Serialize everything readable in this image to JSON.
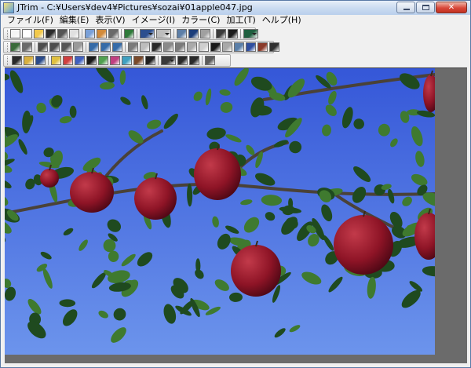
{
  "window": {
    "title": "JTrim - C:¥Users¥dev4¥Pictures¥sozai¥01apple047.jpg"
  },
  "menu": [
    {
      "label": "ファイル(F)"
    },
    {
      "label": "編集(E)"
    },
    {
      "label": "表示(V)"
    },
    {
      "label": "イメージ(I)"
    },
    {
      "label": "カラー(C)"
    },
    {
      "label": "加工(T)"
    },
    {
      "label": "ヘルプ(H)"
    }
  ],
  "toolbar_rows": [
    [
      {
        "name": "copy-window",
        "color": "#f5f5f5"
      },
      {
        "name": "new-file",
        "color": "#ffffff"
      },
      {
        "name": "open-folder",
        "color": "#f2c94c"
      },
      {
        "name": "save",
        "color": "#2b2b2b"
      },
      {
        "name": "print",
        "color": "#555555"
      },
      {
        "name": "print-preview",
        "color": "#e0e0e0"
      },
      "sep",
      {
        "name": "copy",
        "color": "#7aa0d8"
      },
      {
        "name": "paste",
        "color": "#d28b3b"
      },
      {
        "name": "paste-new",
        "color": "#6a6a6a"
      },
      "sep",
      {
        "name": "fill",
        "color": "#2f7a3a"
      },
      "sep",
      {
        "name": "undo",
        "color": "#2d4f8f",
        "dropdown": true
      },
      {
        "name": "redo",
        "color": "#bdbdbd",
        "dropdown": true
      },
      "sep",
      {
        "name": "zoom-fit",
        "color": "#5d7fa8"
      },
      {
        "name": "text",
        "color": "#1b3d7a"
      },
      {
        "name": "shape",
        "color": "#a0a0a0"
      },
      "sep",
      {
        "name": "grid",
        "color": "#3a3a3a"
      },
      {
        "name": "ruler",
        "color": "#1c1c1c"
      },
      "sep",
      {
        "name": "display-mode",
        "color": "#1f5f3f",
        "dropdown": true
      }
    ],
    [
      {
        "name": "crop",
        "color": "#3a6b3a"
      },
      {
        "name": "resize",
        "color": "#6a6a6a"
      },
      "sep",
      {
        "name": "rotate-left",
        "color": "#4d4d4d"
      },
      {
        "name": "rotate-right",
        "color": "#4d4d4d"
      },
      {
        "name": "flip",
        "color": "#555555"
      },
      {
        "name": "frame",
        "color": "#9a9a9a"
      },
      "sep",
      {
        "name": "rotate-ccw",
        "color": "#356ba8"
      },
      {
        "name": "rotate-cw",
        "color": "#356ba8"
      },
      {
        "name": "rotate-free",
        "color": "#356ba8"
      },
      "sep",
      {
        "name": "layers",
        "color": "#7a7a7a"
      },
      {
        "name": "shadow",
        "color": "#bdbdbd"
      },
      {
        "name": "sun-filter",
        "color": "#2a2a2a"
      },
      {
        "name": "wave-filter",
        "color": "#8a8a8a"
      },
      {
        "name": "hatch-filter",
        "color": "#7a7a7a"
      },
      {
        "name": "blur-filter",
        "color": "#aaaaaa"
      },
      {
        "name": "emboss",
        "color": "#cfcfcf"
      },
      {
        "name": "mono",
        "color": "#1a1a1a"
      },
      {
        "name": "film",
        "color": "#a8a8a8"
      },
      {
        "name": "sharpen",
        "color": "#5a7fa8"
      },
      {
        "name": "pen",
        "color": "#2f4f9f"
      },
      {
        "name": "eraser",
        "color": "#8a3a2a"
      },
      {
        "name": "spiral",
        "color": "#2f2f2f"
      }
    ],
    [
      {
        "name": "brightness",
        "color": "#2a2a2a"
      },
      {
        "name": "contrast",
        "color": "#d8b040"
      },
      {
        "name": "gamma",
        "color": "#2a4a8a"
      },
      "sep",
      {
        "name": "auto-level",
        "color": "#e0c040"
      },
      {
        "name": "color-balance",
        "color": "#d04040"
      },
      {
        "name": "hue",
        "color": "#4060c0"
      },
      {
        "name": "saturation",
        "color": "#1a1a1a"
      },
      {
        "name": "tone-curve",
        "color": "#50a050"
      },
      {
        "name": "posterize",
        "color": "#c04080"
      },
      {
        "name": "color-replace",
        "color": "#40a0c0"
      },
      {
        "name": "palette",
        "color": "#7a4a2a"
      },
      {
        "name": "mosaic",
        "color": "#202020"
      },
      "sep",
      {
        "name": "zoom",
        "color": "#3a3a3a",
        "dropdown": true
      },
      {
        "name": "zoom-in",
        "color": "#2a2a2a"
      },
      {
        "name": "zoom-out",
        "color": "#2a2a2a"
      },
      "sep",
      {
        "name": "eyedropper",
        "color": "#5a5a5a"
      }
    ]
  ],
  "photo": {
    "colors": {
      "sky_top": "#3557d8",
      "sky_bottom": "#6c94ec",
      "leaf": "#1f4a1f",
      "leaf_light": "#3f7a2f",
      "apple": "#8e1426",
      "apple_light": "#c23a4a"
    }
  }
}
